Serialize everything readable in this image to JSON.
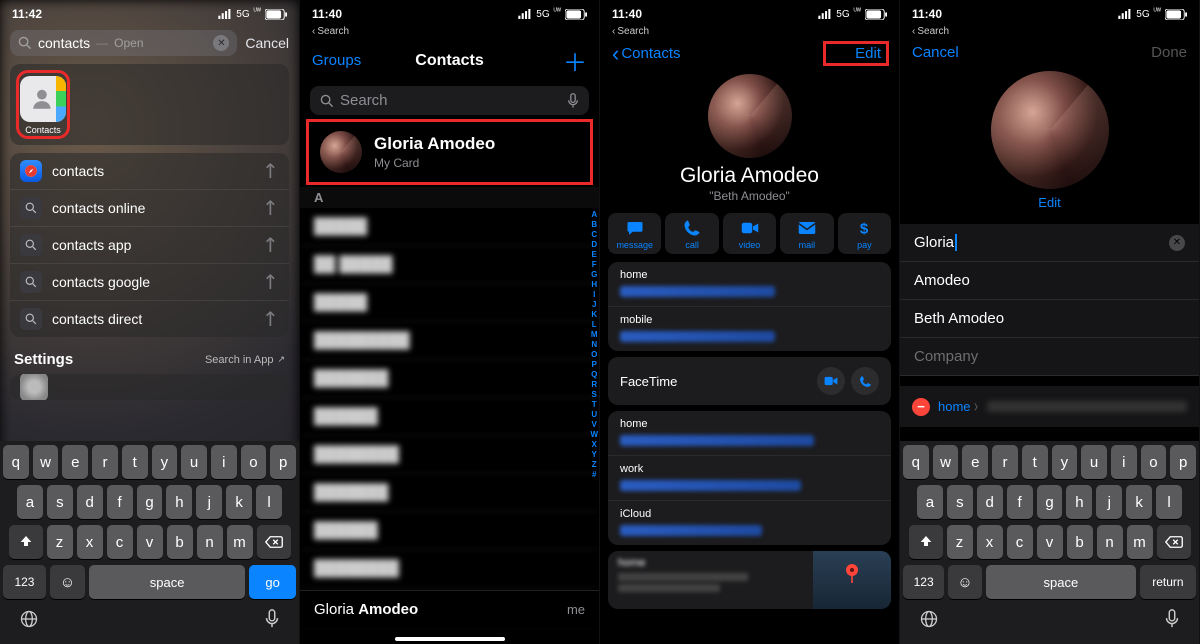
{
  "status": {
    "time1": "11:42",
    "time_rest": "11:40",
    "net": "5G",
    "uw": "ᵁ",
    "loc": "➤"
  },
  "back_search": "Search",
  "p1": {
    "query": "contacts",
    "open_hint": "Open",
    "cancel": "Cancel",
    "app_label": "Contacts",
    "suggestions": [
      "contacts",
      "contacts online",
      "contacts app",
      "contacts google",
      "contacts direct"
    ],
    "settings_header": "Settings",
    "search_in_app": "Search in App",
    "kb_rows": [
      [
        "q",
        "w",
        "e",
        "r",
        "t",
        "y",
        "u",
        "i",
        "o",
        "p"
      ],
      [
        "a",
        "s",
        "d",
        "f",
        "g",
        "h",
        "j",
        "k",
        "l"
      ],
      [
        "z",
        "x",
        "c",
        "v",
        "b",
        "n",
        "m"
      ]
    ],
    "kb_123": "123",
    "kb_space": "space",
    "kb_go": "go"
  },
  "p2": {
    "groups": "Groups",
    "title": "Contacts",
    "search_ph": "Search",
    "me_name": "Gloria Amodeo",
    "me_sub": "My Card",
    "section": "A",
    "rows": [
      "█████",
      "██ █████",
      "█████",
      "█████████",
      "███████",
      "██████",
      "████████",
      "███████",
      "██████",
      "████████",
      "█████ █████"
    ],
    "index": [
      "A",
      "B",
      "C",
      "D",
      "E",
      "F",
      "G",
      "H",
      "I",
      "J",
      "K",
      "L",
      "M",
      "N",
      "O",
      "P",
      "Q",
      "R",
      "S",
      "T",
      "U",
      "V",
      "W",
      "X",
      "Y",
      "Z",
      "#"
    ],
    "bottom_name_first": "Gloria ",
    "bottom_name_last": "Amodeo",
    "me": "me"
  },
  "p3": {
    "back": "Contacts",
    "edit": "Edit",
    "name": "Gloria Amodeo",
    "nick": "\"Beth Amodeo\"",
    "actions": [
      {
        "k": "message",
        "l": "message"
      },
      {
        "k": "call",
        "l": "call"
      },
      {
        "k": "video",
        "l": "video"
      },
      {
        "k": "mail",
        "l": "mail"
      },
      {
        "k": "pay",
        "l": "pay"
      }
    ],
    "phones": [
      {
        "l": "home"
      },
      {
        "l": "mobile"
      }
    ],
    "facetime": "FaceTime",
    "emails": [
      {
        "l": "home"
      },
      {
        "l": "work"
      },
      {
        "l": "iCloud"
      }
    ],
    "addr_label": "home"
  },
  "p4": {
    "cancel": "Cancel",
    "done": "Done",
    "edit": "Edit",
    "first": "Gloria",
    "last": "Amodeo",
    "nick": "Beth Amodeo",
    "company_ph": "Company",
    "ph_label": "home",
    "kb_rows": [
      [
        "q",
        "w",
        "e",
        "r",
        "t",
        "y",
        "u",
        "i",
        "o",
        "p"
      ],
      [
        "a",
        "s",
        "d",
        "f",
        "g",
        "h",
        "j",
        "k",
        "l"
      ],
      [
        "z",
        "x",
        "c",
        "v",
        "b",
        "n",
        "m"
      ]
    ],
    "kb_123": "123",
    "kb_space": "space",
    "kb_return": "return"
  }
}
